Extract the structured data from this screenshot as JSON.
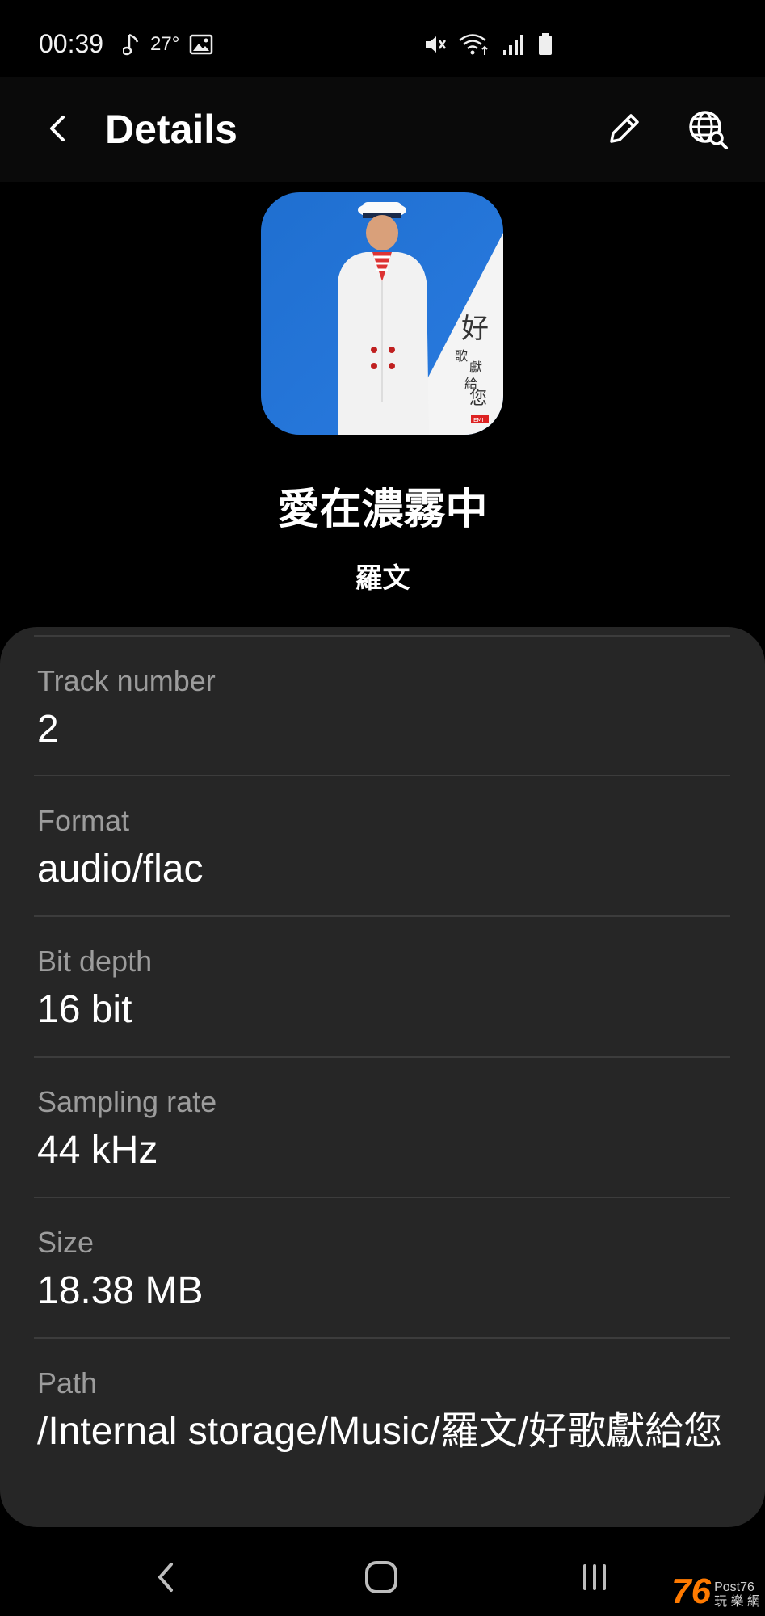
{
  "status_bar": {
    "time": "00:39",
    "temperature": "27°",
    "left_icons": [
      "music-note-icon",
      "gallery-icon"
    ],
    "right_icons": [
      "mute-icon",
      "wifi-icon",
      "signal-icon",
      "battery-icon"
    ]
  },
  "app_bar": {
    "title": "Details",
    "actions": [
      "edit-icon",
      "web-search-icon"
    ]
  },
  "song": {
    "title": "愛在濃霧中",
    "artist": "羅文",
    "album_art_text": [
      "好",
      "歌",
      "獻",
      "給",
      "您",
      "EMI"
    ]
  },
  "details": [
    {
      "label": "Track number",
      "value": "2"
    },
    {
      "label": "Format",
      "value": "audio/flac"
    },
    {
      "label": "Bit depth",
      "value": "16 bit"
    },
    {
      "label": "Sampling rate",
      "value": "44 kHz"
    },
    {
      "label": "Size",
      "value": "18.38 MB"
    },
    {
      "label": "Path",
      "value": "/Internal storage/Music/羅文/好歌獻給您"
    }
  ],
  "nav_bar": {
    "buttons": [
      "back-nav-icon",
      "home-nav-icon",
      "recent-apps-icon"
    ]
  },
  "watermark": {
    "number": "76",
    "line1": "Post76",
    "line2": "玩 樂 網"
  },
  "colors": {
    "background": "#000000",
    "card": "#262626",
    "label": "#9c9c9c",
    "value": "#ffffff",
    "divider": "#3c3c3c"
  }
}
